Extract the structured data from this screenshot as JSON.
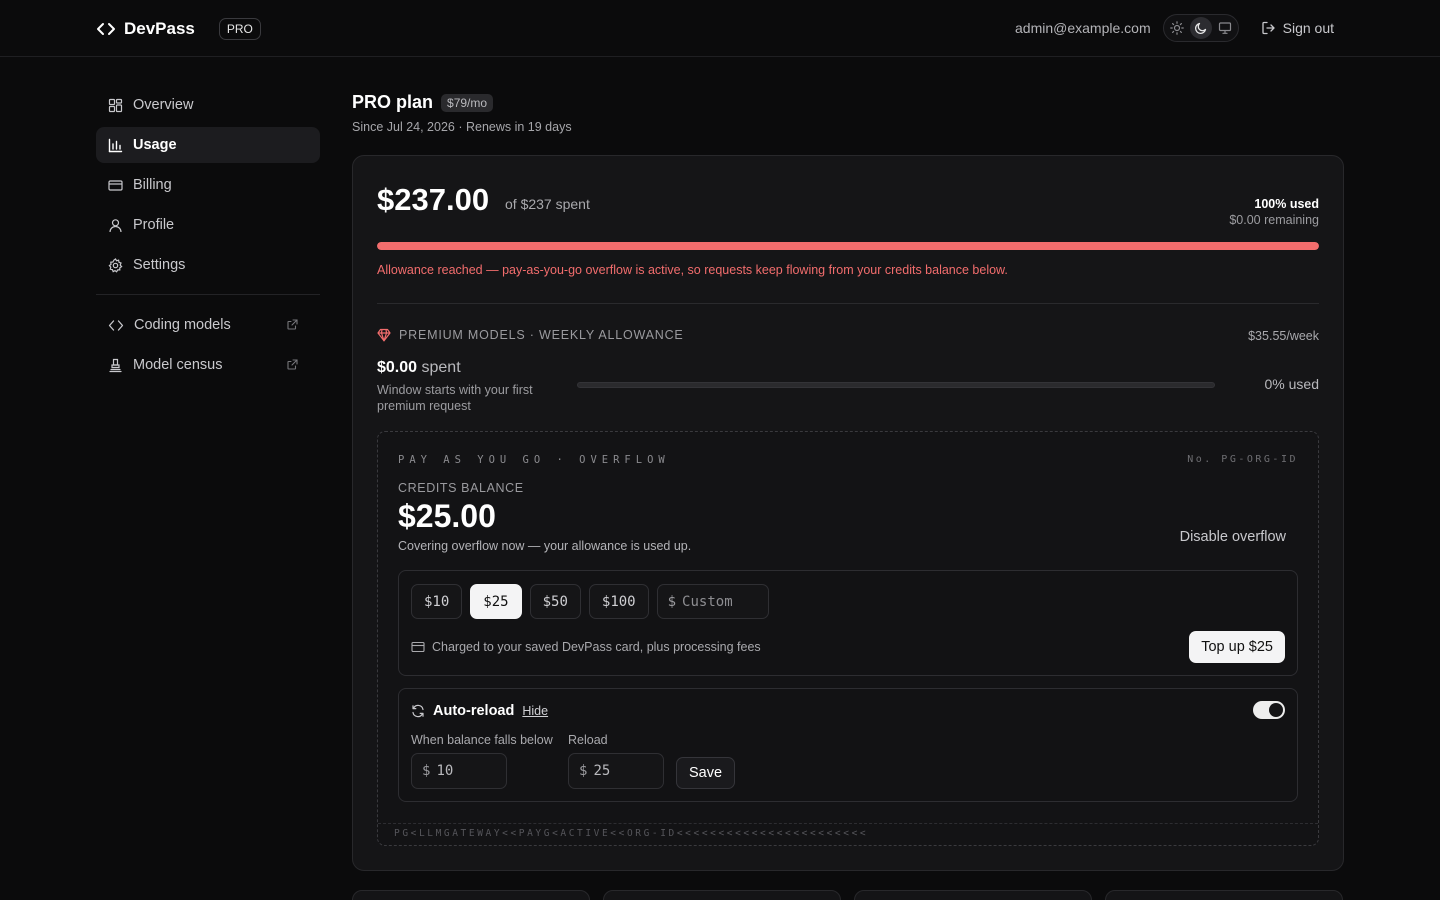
{
  "header": {
    "brand": "DevPass",
    "badge": "PRO",
    "email": "admin@example.com",
    "theme_options": [
      "sun-icon",
      "moon-icon",
      "monitor-icon"
    ],
    "theme_active": "moon-icon",
    "sign_out": "Sign out"
  },
  "sidebar": {
    "items": [
      {
        "label": "Overview",
        "icon": "grid-icon",
        "active": false
      },
      {
        "label": "Usage",
        "icon": "bar-chart-icon",
        "active": true
      },
      {
        "label": "Billing",
        "icon": "credit-card-icon",
        "active": false
      },
      {
        "label": "Profile",
        "icon": "user-icon",
        "active": false
      },
      {
        "label": "Settings",
        "icon": "gear-icon",
        "active": false
      }
    ],
    "external": [
      {
        "label": "Coding models",
        "icon": "code-icon"
      },
      {
        "label": "Model census",
        "icon": "census-icon"
      }
    ]
  },
  "plan": {
    "title": "PRO plan",
    "price": "$79/mo",
    "subtitle": "Since Jul 24, 2026 · Renews in 19 days"
  },
  "usage": {
    "spent": "$237.00",
    "of_label": "of $237 spent",
    "used_pct": "100% used",
    "remaining": "$0.00 remaining",
    "progress": 1.0,
    "alert": "Allowance reached — pay-as-you-go overflow is active, so requests keep flowing from your credits balance below.",
    "colors": {
      "alert": "#f26d6d"
    }
  },
  "premium": {
    "heading": "PREMIUM MODELS · WEEKLY ALLOWANCE",
    "rate": "$35.55/week",
    "spent_value": "$0.00",
    "spent_suffix": "spent",
    "note": "Window starts with your first premium request",
    "used": "0% used",
    "progress": 0.0
  },
  "payg": {
    "tag": "PAY AS YOU GO · OVERFLOW",
    "number": "No. PG-ORG-ID",
    "credits_label": "CREDITS BALANCE",
    "credits_amount": "$25.00",
    "credits_note": "Covering overflow now — your allowance is used up.",
    "disable": "Disable overflow",
    "amounts": [
      "$10",
      "$25",
      "$50",
      "$100"
    ],
    "selected_amount": "$25",
    "custom_currency": "$",
    "custom_placeholder": "Custom",
    "charged_note": "Charged to your saved DevPass card, plus processing fees",
    "topup_label": "Top up $25",
    "auto_reload": {
      "title": "Auto-reload",
      "hide": "Hide",
      "enabled": true,
      "threshold_label": "When balance falls below",
      "threshold_currency": "$",
      "threshold_value": "10",
      "reload_label": "Reload",
      "reload_currency": "$",
      "reload_value": "25",
      "save": "Save"
    },
    "mrz": "PG<LLMGATEWAY<<PAYG<ACTIVE<<ORG-ID<<<<<<<<<<<<<<<<<<<<<<<"
  }
}
